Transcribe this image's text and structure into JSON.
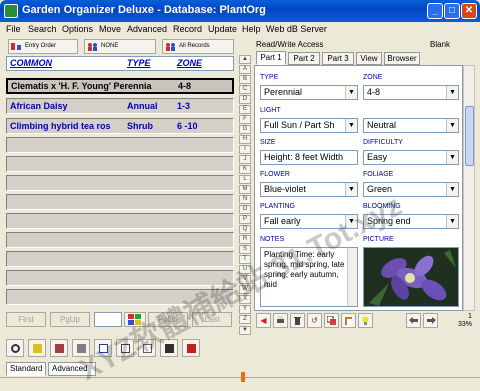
{
  "window": {
    "title": "Garden Organizer Deluxe - Database: PlantOrg",
    "min_label": "_",
    "max_label": "□",
    "close_label": "✕"
  },
  "menu": [
    "File",
    "Search",
    "Options",
    "Move",
    "Advanced",
    "Record",
    "Update",
    "Help",
    "Web dB Server"
  ],
  "left_toolbar": {
    "entry_order": "Entry Order",
    "none": "NONE",
    "all_records": "All Records"
  },
  "list": {
    "headers": {
      "common": "COMMON",
      "type": "TYPE",
      "zone": "ZONE"
    },
    "rows": [
      {
        "common": "Clematis x 'H. F. Young' Perennia",
        "type": "",
        "zone": "4-8",
        "selected": true
      },
      {
        "common": "African Daisy",
        "type": "Annual",
        "zone": "1-3",
        "selected": false
      },
      {
        "common": "Climbing hybrid tea ros",
        "type": "Shrub",
        "zone": "6 -10",
        "selected": false
      }
    ],
    "empty_rows": 11
  },
  "nav": {
    "first": "First",
    "pgup": "PgUp",
    "pgdn": "PgDn",
    "last": "Last"
  },
  "mode_tabs": {
    "standard": "Standard",
    "advanced": "Advanced"
  },
  "alphabet": [
    "A",
    "B",
    "C",
    "D",
    "E",
    "F",
    "G",
    "H",
    "I",
    "J",
    "K",
    "L",
    "M",
    "N",
    "O",
    "P",
    "Q",
    "R",
    "S",
    "T",
    "U",
    "V",
    "W",
    "X",
    "Y",
    "Z"
  ],
  "alpha_up": "▲",
  "alpha_down": "▼",
  "record": {
    "access": "Read/Write Access",
    "blank": "Blank",
    "tabs": [
      "Part 1",
      "Part 2",
      "Part 3",
      "View",
      "Browser"
    ],
    "fields": {
      "type_label": "TYPE",
      "type_value": "Perennial",
      "zone_label": "ZONE",
      "zone_value": "4-8",
      "light_label": "LIGHT",
      "light_value": "Full Sun / Part Sh",
      "ph_value": "Neutral",
      "size_label": "SIZE",
      "size_value": "Height: 8 feet  Width",
      "difficulty_label": "DIFFICULTY",
      "difficulty_value": "Easy",
      "flower_label": "FLOWER",
      "flower_value": "Blue-violet",
      "foliage_label": "FOLIAGE",
      "foliage_value": "Green",
      "planting_label": "PLANTING",
      "planting_value": "Fall early",
      "blooming_label": "BLOOMING",
      "blooming_value": "Spring end",
      "notes_label": "NOTES",
      "notes_value": "Planting Time: early spring, mid spring, late spring, early autumn, mid",
      "picture_label": "PICTURE"
    },
    "zoom": "33%",
    "page_num": "1"
  },
  "watermark": "XYZ软體補給站 31.Tot.xyz"
}
